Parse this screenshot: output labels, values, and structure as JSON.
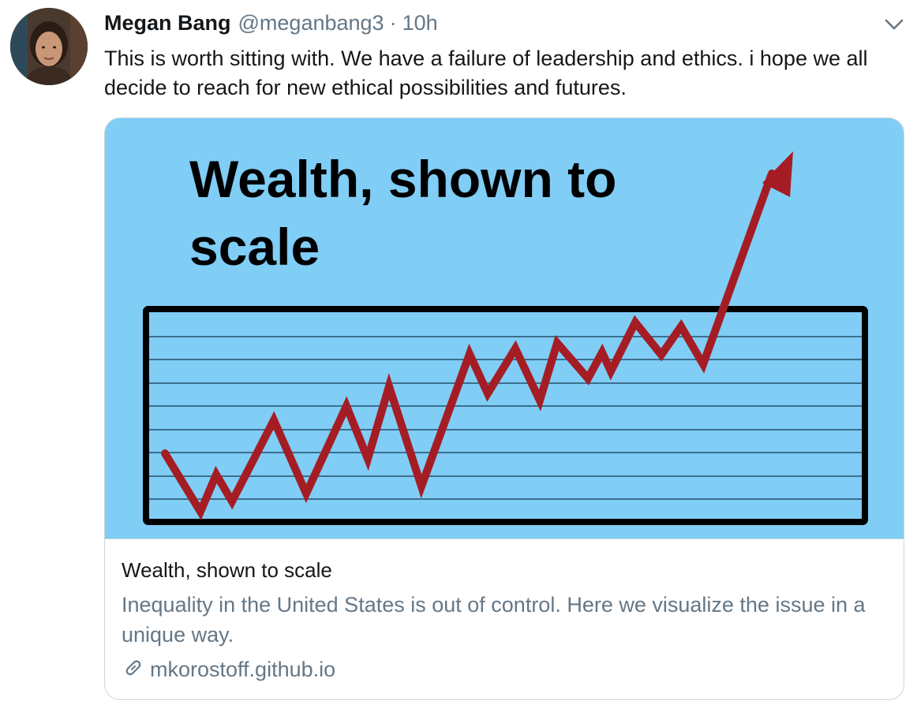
{
  "tweet": {
    "author_name": "Megan Bang",
    "author_handle": "@meganbang3",
    "separator": "·",
    "timestamp": "10h",
    "text": "This is worth sitting with. We have a failure of leadership and ethics. i hope we all decide to reach for new ethical possibilities and futures."
  },
  "card": {
    "image_title": "Wealth, shown to scale",
    "title": "Wealth, shown to scale",
    "description": "Inequality in the United States is out of control. Here we visualize the issue in a unique way.",
    "domain": "mkorostoff.github.io"
  },
  "icons": {
    "caret": "chevron-down-icon",
    "link": "link-icon"
  },
  "colors": {
    "card_image_bg": "#80cdf6",
    "line": "#a51d24",
    "frame": "#000000",
    "muted_text": "#657786"
  }
}
